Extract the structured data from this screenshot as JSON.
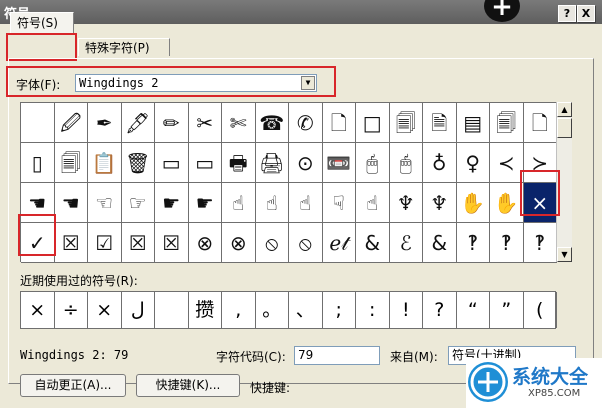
{
  "window": {
    "title": "符号",
    "help_button": "?",
    "close_button": "X"
  },
  "tabs": [
    {
      "label": "符号(S)"
    },
    {
      "label": "特殊字符(P)"
    }
  ],
  "font": {
    "label": "字体(F):",
    "value": "Wingdings 2"
  },
  "symbol_grid": [
    [
      "",
      "🖉",
      "✒",
      "🖋",
      "✏",
      "✂",
      "✄",
      "☎",
      "✆",
      "🗋",
      "□",
      "🗐",
      "🗎",
      "▤",
      "🗐",
      "🗋"
    ],
    [
      "▯",
      "🗐",
      "📋",
      "🗑",
      "▭",
      "▭",
      "🖶",
      "🖨",
      "⊙",
      "📼",
      "🖱",
      "🖱",
      "♁",
      "♀",
      "≺",
      "≻"
    ],
    [
      "☚",
      "☚",
      "☜",
      "☞",
      "☛",
      "☛",
      "☝",
      "☝",
      "☝",
      "☟",
      "☝",
      "♆",
      "♆",
      "✋",
      "✋",
      "×"
    ],
    [
      "✓",
      "☒",
      "☑",
      "☒",
      "☒",
      "⊗",
      "⊗",
      "⦸",
      "⦸",
      "ℯ𝓉",
      "&",
      "ℰ",
      "&",
      "‽",
      "‽",
      "‽"
    ]
  ],
  "selected_symbol": {
    "row": 2,
    "col": 15
  },
  "recent": {
    "label": "近期使用过的符号(R):",
    "symbols": [
      "×",
      "÷",
      "×",
      "ل",
      "",
      "攒",
      ",",
      "。",
      "、",
      ";",
      ":",
      "!",
      "?",
      "“",
      "”",
      "("
    ]
  },
  "info": {
    "font_code": "Wingdings 2: 79",
    "char_code_label": "字符代码(C):",
    "char_code_value": "79",
    "from_label": "来自(M):",
    "from_value": "符号(十进制)"
  },
  "buttons": {
    "autocorrect": "自动更正(A)...",
    "shortcut_key": "快捷键(K)...",
    "shortcut_label": "快捷键:"
  },
  "watermark": {
    "text": "系统大全",
    "sub": "XP85.COM"
  }
}
